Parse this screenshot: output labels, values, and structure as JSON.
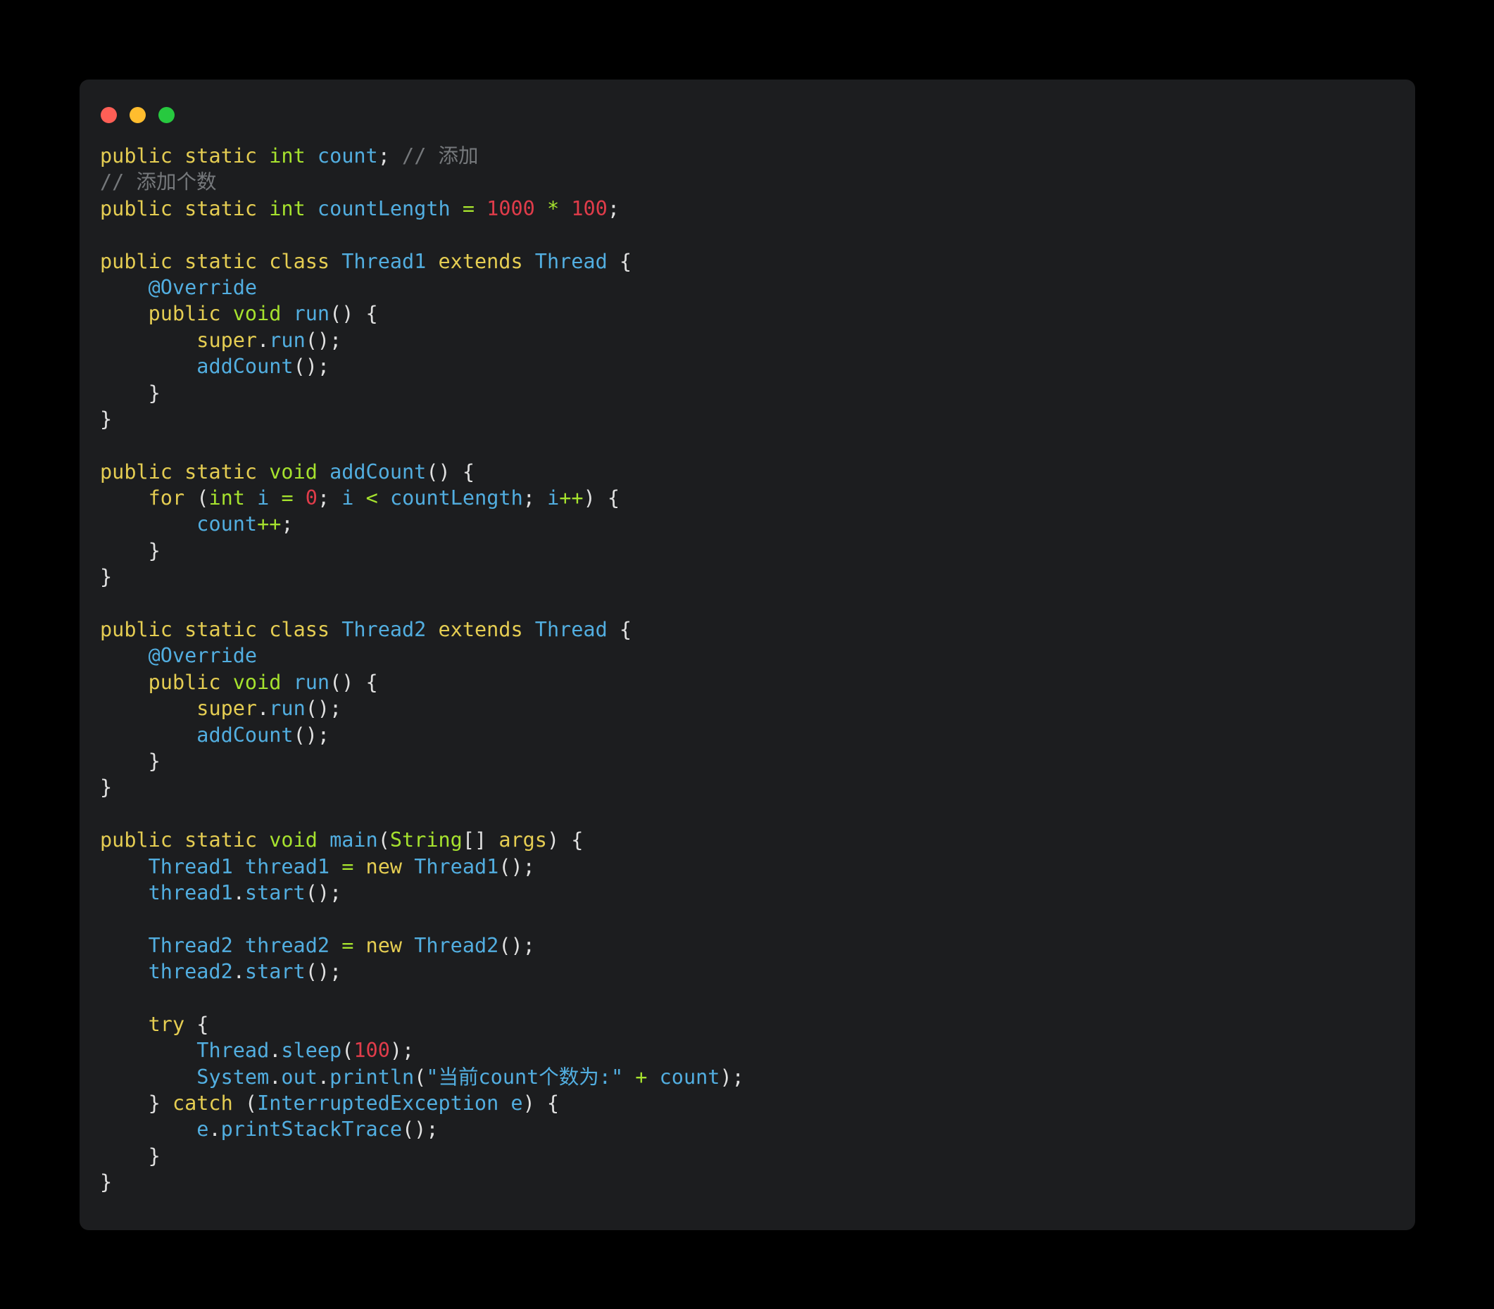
{
  "window": {
    "background": "#1c1d1f",
    "page_background": "#000000",
    "controls": [
      {
        "name": "close",
        "color": "#ff5f56"
      },
      {
        "name": "minimize",
        "color": "#ffbd2e"
      },
      {
        "name": "maximize",
        "color": "#27c93f"
      }
    ]
  },
  "theme": {
    "keyword": "#e5cd52",
    "type": "#a6e22e",
    "identifier": "#52aee0",
    "number": "#e03c4a",
    "operator": "#a6e22e",
    "comment": "#75787b",
    "punctuation": "#e0e0e0",
    "string": "#52aee0"
  },
  "code": {
    "language": "Java",
    "lines": [
      [
        {
          "t": "public",
          "c": "kw"
        },
        {
          "t": " ",
          "c": "pun"
        },
        {
          "t": "static",
          "c": "kw"
        },
        {
          "t": " ",
          "c": "pun"
        },
        {
          "t": "int",
          "c": "typ"
        },
        {
          "t": " ",
          "c": "pun"
        },
        {
          "t": "count",
          "c": "id"
        },
        {
          "t": "; ",
          "c": "pun"
        },
        {
          "t": "// 添加",
          "c": "cmt"
        }
      ],
      [
        {
          "t": "// 添加个数",
          "c": "cmt"
        }
      ],
      [
        {
          "t": "public",
          "c": "kw"
        },
        {
          "t": " ",
          "c": "pun"
        },
        {
          "t": "static",
          "c": "kw"
        },
        {
          "t": " ",
          "c": "pun"
        },
        {
          "t": "int",
          "c": "typ"
        },
        {
          "t": " ",
          "c": "pun"
        },
        {
          "t": "countLength",
          "c": "id"
        },
        {
          "t": " ",
          "c": "pun"
        },
        {
          "t": "=",
          "c": "op"
        },
        {
          "t": " ",
          "c": "pun"
        },
        {
          "t": "1000",
          "c": "num"
        },
        {
          "t": " ",
          "c": "pun"
        },
        {
          "t": "*",
          "c": "op"
        },
        {
          "t": " ",
          "c": "pun"
        },
        {
          "t": "100",
          "c": "num"
        },
        {
          "t": ";",
          "c": "pun"
        }
      ],
      [],
      [
        {
          "t": "public",
          "c": "kw"
        },
        {
          "t": " ",
          "c": "pun"
        },
        {
          "t": "static",
          "c": "kw"
        },
        {
          "t": " ",
          "c": "pun"
        },
        {
          "t": "class",
          "c": "kw"
        },
        {
          "t": " ",
          "c": "pun"
        },
        {
          "t": "Thread1",
          "c": "id"
        },
        {
          "t": " ",
          "c": "pun"
        },
        {
          "t": "extends",
          "c": "kw"
        },
        {
          "t": " ",
          "c": "pun"
        },
        {
          "t": "Thread",
          "c": "id"
        },
        {
          "t": " {",
          "c": "pun"
        }
      ],
      [
        {
          "t": "    ",
          "c": "pun"
        },
        {
          "t": "@Override",
          "c": "id"
        }
      ],
      [
        {
          "t": "    ",
          "c": "pun"
        },
        {
          "t": "public",
          "c": "kw"
        },
        {
          "t": " ",
          "c": "pun"
        },
        {
          "t": "void",
          "c": "typ"
        },
        {
          "t": " ",
          "c": "pun"
        },
        {
          "t": "run",
          "c": "id"
        },
        {
          "t": "() {",
          "c": "pun"
        }
      ],
      [
        {
          "t": "        ",
          "c": "pun"
        },
        {
          "t": "super",
          "c": "kw"
        },
        {
          "t": ".",
          "c": "pun"
        },
        {
          "t": "run",
          "c": "id"
        },
        {
          "t": "();",
          "c": "pun"
        }
      ],
      [
        {
          "t": "        ",
          "c": "pun"
        },
        {
          "t": "addCount",
          "c": "id"
        },
        {
          "t": "();",
          "c": "pun"
        }
      ],
      [
        {
          "t": "    }",
          "c": "pun"
        }
      ],
      [
        {
          "t": "}",
          "c": "pun"
        }
      ],
      [],
      [
        {
          "t": "public",
          "c": "kw"
        },
        {
          "t": " ",
          "c": "pun"
        },
        {
          "t": "static",
          "c": "kw"
        },
        {
          "t": " ",
          "c": "pun"
        },
        {
          "t": "void",
          "c": "typ"
        },
        {
          "t": " ",
          "c": "pun"
        },
        {
          "t": "addCount",
          "c": "id"
        },
        {
          "t": "() {",
          "c": "pun"
        }
      ],
      [
        {
          "t": "    ",
          "c": "pun"
        },
        {
          "t": "for",
          "c": "kw"
        },
        {
          "t": " (",
          "c": "pun"
        },
        {
          "t": "int",
          "c": "typ"
        },
        {
          "t": " ",
          "c": "pun"
        },
        {
          "t": "i",
          "c": "id"
        },
        {
          "t": " ",
          "c": "pun"
        },
        {
          "t": "=",
          "c": "op"
        },
        {
          "t": " ",
          "c": "pun"
        },
        {
          "t": "0",
          "c": "num"
        },
        {
          "t": "; ",
          "c": "pun"
        },
        {
          "t": "i",
          "c": "id"
        },
        {
          "t": " ",
          "c": "pun"
        },
        {
          "t": "<",
          "c": "op"
        },
        {
          "t": " ",
          "c": "pun"
        },
        {
          "t": "countLength",
          "c": "id"
        },
        {
          "t": "; ",
          "c": "pun"
        },
        {
          "t": "i",
          "c": "id"
        },
        {
          "t": "++",
          "c": "op"
        },
        {
          "t": ") {",
          "c": "pun"
        }
      ],
      [
        {
          "t": "        ",
          "c": "pun"
        },
        {
          "t": "count",
          "c": "id"
        },
        {
          "t": "++",
          "c": "op"
        },
        {
          "t": ";",
          "c": "pun"
        }
      ],
      [
        {
          "t": "    }",
          "c": "pun"
        }
      ],
      [
        {
          "t": "}",
          "c": "pun"
        }
      ],
      [],
      [
        {
          "t": "public",
          "c": "kw"
        },
        {
          "t": " ",
          "c": "pun"
        },
        {
          "t": "static",
          "c": "kw"
        },
        {
          "t": " ",
          "c": "pun"
        },
        {
          "t": "class",
          "c": "kw"
        },
        {
          "t": " ",
          "c": "pun"
        },
        {
          "t": "Thread2",
          "c": "id"
        },
        {
          "t": " ",
          "c": "pun"
        },
        {
          "t": "extends",
          "c": "kw"
        },
        {
          "t": " ",
          "c": "pun"
        },
        {
          "t": "Thread",
          "c": "id"
        },
        {
          "t": " {",
          "c": "pun"
        }
      ],
      [
        {
          "t": "    ",
          "c": "pun"
        },
        {
          "t": "@Override",
          "c": "id"
        }
      ],
      [
        {
          "t": "    ",
          "c": "pun"
        },
        {
          "t": "public",
          "c": "kw"
        },
        {
          "t": " ",
          "c": "pun"
        },
        {
          "t": "void",
          "c": "typ"
        },
        {
          "t": " ",
          "c": "pun"
        },
        {
          "t": "run",
          "c": "id"
        },
        {
          "t": "() {",
          "c": "pun"
        }
      ],
      [
        {
          "t": "        ",
          "c": "pun"
        },
        {
          "t": "super",
          "c": "kw"
        },
        {
          "t": ".",
          "c": "pun"
        },
        {
          "t": "run",
          "c": "id"
        },
        {
          "t": "();",
          "c": "pun"
        }
      ],
      [
        {
          "t": "        ",
          "c": "pun"
        },
        {
          "t": "addCount",
          "c": "id"
        },
        {
          "t": "();",
          "c": "pun"
        }
      ],
      [
        {
          "t": "    }",
          "c": "pun"
        }
      ],
      [
        {
          "t": "}",
          "c": "pun"
        }
      ],
      [],
      [
        {
          "t": "public",
          "c": "kw"
        },
        {
          "t": " ",
          "c": "pun"
        },
        {
          "t": "static",
          "c": "kw"
        },
        {
          "t": " ",
          "c": "pun"
        },
        {
          "t": "void",
          "c": "typ"
        },
        {
          "t": " ",
          "c": "pun"
        },
        {
          "t": "main",
          "c": "id"
        },
        {
          "t": "(",
          "c": "pun"
        },
        {
          "t": "String",
          "c": "typ"
        },
        {
          "t": "[] ",
          "c": "pun"
        },
        {
          "t": "args",
          "c": "kw"
        },
        {
          "t": ") {",
          "c": "pun"
        }
      ],
      [
        {
          "t": "    ",
          "c": "pun"
        },
        {
          "t": "Thread1",
          "c": "id"
        },
        {
          "t": " ",
          "c": "pun"
        },
        {
          "t": "thread1",
          "c": "id"
        },
        {
          "t": " ",
          "c": "pun"
        },
        {
          "t": "=",
          "c": "op"
        },
        {
          "t": " ",
          "c": "pun"
        },
        {
          "t": "new",
          "c": "kw"
        },
        {
          "t": " ",
          "c": "pun"
        },
        {
          "t": "Thread1",
          "c": "id"
        },
        {
          "t": "();",
          "c": "pun"
        }
      ],
      [
        {
          "t": "    ",
          "c": "pun"
        },
        {
          "t": "thread1",
          "c": "id"
        },
        {
          "t": ".",
          "c": "pun"
        },
        {
          "t": "start",
          "c": "id"
        },
        {
          "t": "();",
          "c": "pun"
        }
      ],
      [],
      [
        {
          "t": "    ",
          "c": "pun"
        },
        {
          "t": "Thread2",
          "c": "id"
        },
        {
          "t": " ",
          "c": "pun"
        },
        {
          "t": "thread2",
          "c": "id"
        },
        {
          "t": " ",
          "c": "pun"
        },
        {
          "t": "=",
          "c": "op"
        },
        {
          "t": " ",
          "c": "pun"
        },
        {
          "t": "new",
          "c": "kw"
        },
        {
          "t": " ",
          "c": "pun"
        },
        {
          "t": "Thread2",
          "c": "id"
        },
        {
          "t": "();",
          "c": "pun"
        }
      ],
      [
        {
          "t": "    ",
          "c": "pun"
        },
        {
          "t": "thread2",
          "c": "id"
        },
        {
          "t": ".",
          "c": "pun"
        },
        {
          "t": "start",
          "c": "id"
        },
        {
          "t": "();",
          "c": "pun"
        }
      ],
      [],
      [
        {
          "t": "    ",
          "c": "pun"
        },
        {
          "t": "try",
          "c": "kw"
        },
        {
          "t": " {",
          "c": "pun"
        }
      ],
      [
        {
          "t": "        ",
          "c": "pun"
        },
        {
          "t": "Thread",
          "c": "id"
        },
        {
          "t": ".",
          "c": "pun"
        },
        {
          "t": "sleep",
          "c": "id"
        },
        {
          "t": "(",
          "c": "pun"
        },
        {
          "t": "100",
          "c": "num"
        },
        {
          "t": ");",
          "c": "pun"
        }
      ],
      [
        {
          "t": "        ",
          "c": "pun"
        },
        {
          "t": "System",
          "c": "id"
        },
        {
          "t": ".",
          "c": "pun"
        },
        {
          "t": "out",
          "c": "id"
        },
        {
          "t": ".",
          "c": "pun"
        },
        {
          "t": "println",
          "c": "id"
        },
        {
          "t": "(",
          "c": "pun"
        },
        {
          "t": "\"当前count个数为:\"",
          "c": "str"
        },
        {
          "t": " ",
          "c": "pun"
        },
        {
          "t": "+",
          "c": "op"
        },
        {
          "t": " ",
          "c": "pun"
        },
        {
          "t": "count",
          "c": "id"
        },
        {
          "t": ");",
          "c": "pun"
        }
      ],
      [
        {
          "t": "    } ",
          "c": "pun"
        },
        {
          "t": "catch",
          "c": "kw"
        },
        {
          "t": " (",
          "c": "pun"
        },
        {
          "t": "InterruptedException",
          "c": "id"
        },
        {
          "t": " ",
          "c": "pun"
        },
        {
          "t": "e",
          "c": "id"
        },
        {
          "t": ") {",
          "c": "pun"
        }
      ],
      [
        {
          "t": "        ",
          "c": "pun"
        },
        {
          "t": "e",
          "c": "id"
        },
        {
          "t": ".",
          "c": "pun"
        },
        {
          "t": "printStackTrace",
          "c": "id"
        },
        {
          "t": "();",
          "c": "pun"
        }
      ],
      [
        {
          "t": "    }",
          "c": "pun"
        }
      ],
      [
        {
          "t": "}",
          "c": "pun"
        }
      ]
    ]
  }
}
